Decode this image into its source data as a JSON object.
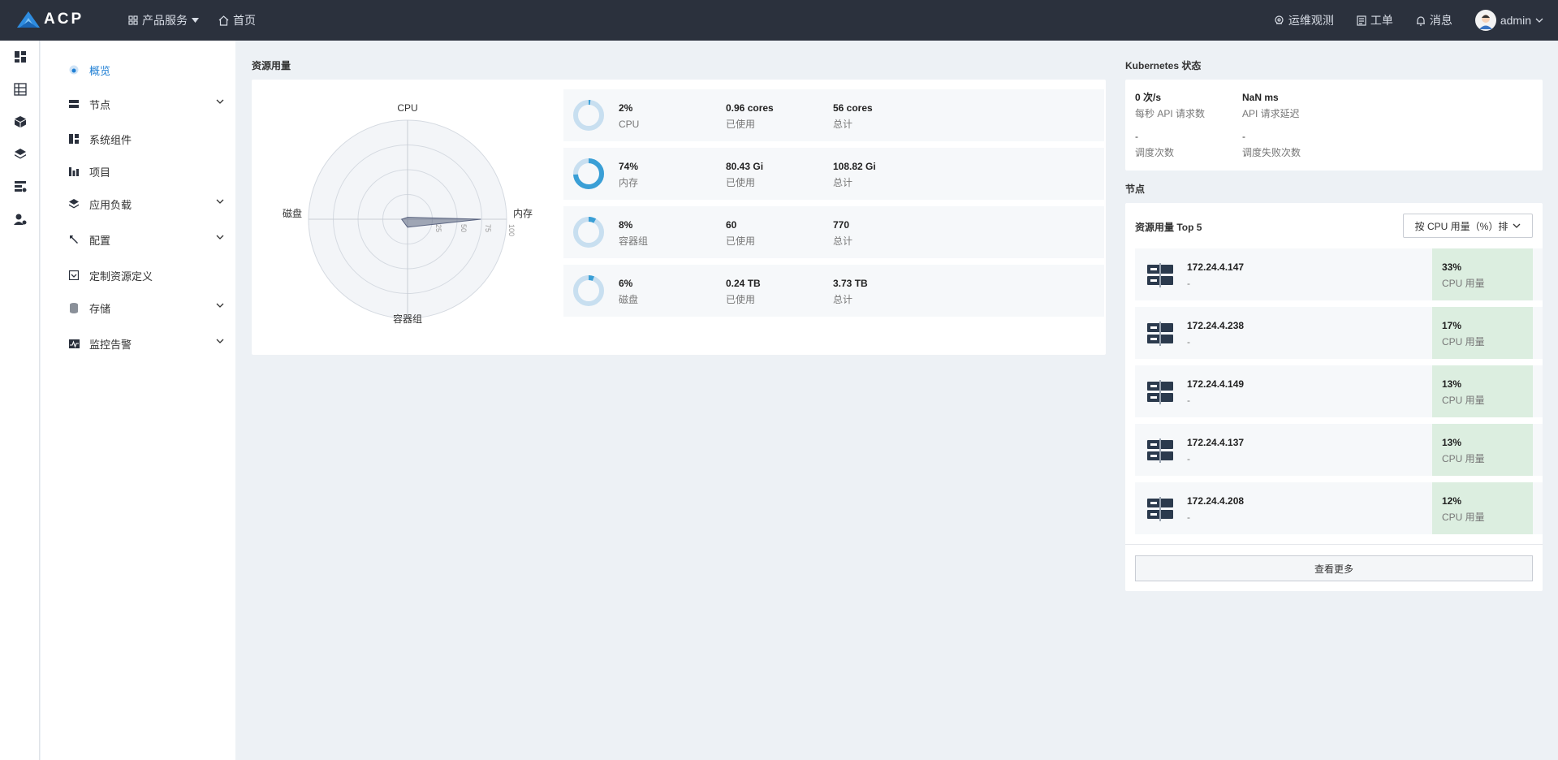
{
  "brand": {
    "name": "ACP"
  },
  "topnav": {
    "products": "产品服务",
    "home": "首页"
  },
  "topright": {
    "ops": "运维观测",
    "tickets": "工单",
    "messages": "消息",
    "user": "admin"
  },
  "sidemenu": [
    {
      "label": "概览",
      "icon": "dashboard-icon",
      "active": true,
      "expandable": false
    },
    {
      "label": "节点",
      "icon": "server-icon",
      "expandable": true
    },
    {
      "label": "系统组件",
      "icon": "component-icon",
      "expandable": false
    },
    {
      "label": "项目",
      "icon": "project-icon",
      "expandable": false
    },
    {
      "label": "应用负载",
      "icon": "layers-icon",
      "expandable": true
    },
    {
      "label": "配置",
      "icon": "wrench-icon",
      "expandable": true
    },
    {
      "label": "定制资源定义",
      "icon": "crd-icon",
      "expandable": false
    },
    {
      "label": "存储",
      "icon": "database-icon",
      "expandable": true
    },
    {
      "label": "监控告警",
      "icon": "monitor-icon",
      "expandable": true
    }
  ],
  "resource": {
    "title": "资源用量",
    "radar_labels": {
      "top": "CPU",
      "right": "内存",
      "bottom": "容器组",
      "left": "磁盘"
    },
    "radar_ticks": [
      "25",
      "50",
      "75",
      "100"
    ],
    "rows": [
      {
        "pct": "2%",
        "name": "CPU",
        "used": "0.96 cores",
        "used_label": "已使用",
        "total": "56 cores",
        "total_label": "总计",
        "fraction": 0.02
      },
      {
        "pct": "74%",
        "name": "内存",
        "used": "80.43 Gi",
        "used_label": "已使用",
        "total": "108.82 Gi",
        "total_label": "总计",
        "fraction": 0.74
      },
      {
        "pct": "8%",
        "name": "容器组",
        "used": "60",
        "used_label": "已使用",
        "total": "770",
        "total_label": "总计",
        "fraction": 0.08
      },
      {
        "pct": "6%",
        "name": "磁盘",
        "used": "0.24 TB",
        "used_label": "已使用",
        "total": "3.73 TB",
        "total_label": "总计",
        "fraction": 0.06
      }
    ]
  },
  "kubernetes": {
    "title": "Kubernetes 状态",
    "stats": [
      {
        "value": "0 次/s",
        "label": "每秒 API 请求数"
      },
      {
        "value": "NaN ms",
        "label": "API 请求延迟"
      },
      {
        "value": "-",
        "label": "调度次数"
      },
      {
        "value": "-",
        "label": "调度失败次数"
      }
    ]
  },
  "nodes": {
    "title": "节点",
    "card_title": "资源用量 Top 5",
    "sort_label": "按 CPU 用量（%）排",
    "more_label": "查看更多",
    "items": [
      {
        "ip": "172.24.4.147",
        "sub": "-",
        "pct": "33%",
        "metric": "CPU 用量"
      },
      {
        "ip": "172.24.4.238",
        "sub": "-",
        "pct": "17%",
        "metric": "CPU 用量"
      },
      {
        "ip": "172.24.4.149",
        "sub": "-",
        "pct": "13%",
        "metric": "CPU 用量"
      },
      {
        "ip": "172.24.4.137",
        "sub": "-",
        "pct": "13%",
        "metric": "CPU 用量"
      },
      {
        "ip": "172.24.4.208",
        "sub": "-",
        "pct": "12%",
        "metric": "CPU 用量"
      }
    ]
  },
  "colors": {
    "accent": "#1f7fd4",
    "donut_fill": "#3a9fd6",
    "donut_track": "#c8dff0",
    "topbar": "#2b313d",
    "pct_bg": "#dceee0"
  }
}
